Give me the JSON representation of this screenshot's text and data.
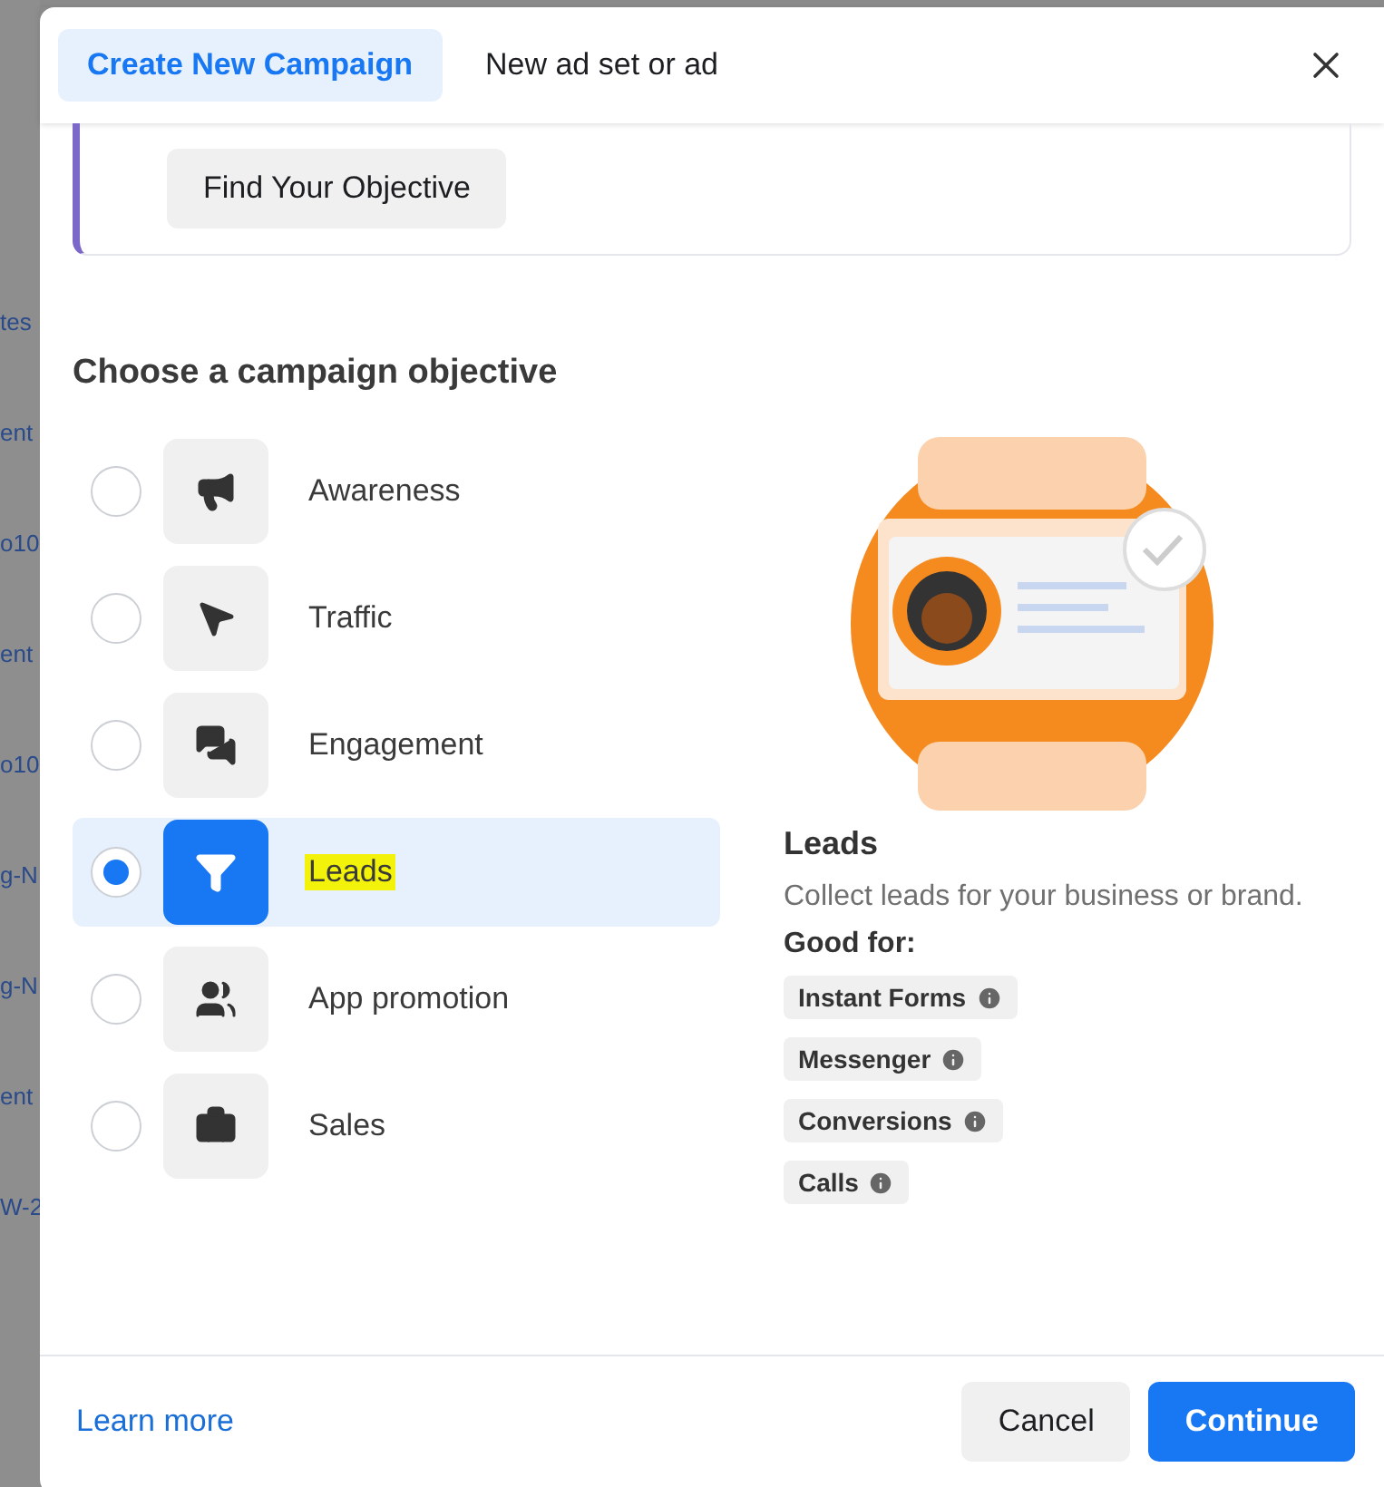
{
  "backdrop": {
    "fragments": [
      "tes",
      "ent",
      "o10",
      "ent",
      "o10",
      "g-N",
      "g-N",
      "ent",
      "W-2"
    ]
  },
  "tabs": [
    {
      "label": "Create New Campaign",
      "selected": true
    },
    {
      "label": "New ad set or ad",
      "selected": false
    }
  ],
  "banner": {
    "button": "Find Your Objective"
  },
  "heading": "Choose a campaign objective",
  "objectives": [
    {
      "label": "Awareness",
      "kind": "megaphone",
      "selected": false,
      "highlighted": false
    },
    {
      "label": "Traffic",
      "kind": "pointer",
      "selected": false,
      "highlighted": false
    },
    {
      "label": "Engagement",
      "kind": "chat",
      "selected": false,
      "highlighted": false
    },
    {
      "label": "Leads",
      "kind": "funnel",
      "selected": true,
      "highlighted": true
    },
    {
      "label": "App promotion",
      "kind": "people",
      "selected": false,
      "highlighted": false
    },
    {
      "label": "Sales",
      "kind": "bag",
      "selected": false,
      "highlighted": false
    }
  ],
  "details": {
    "title": "Leads",
    "description": "Collect leads for your business or brand.",
    "good_for_label": "Good for:",
    "tags": [
      "Instant Forms",
      "Messenger",
      "Conversions",
      "Calls"
    ]
  },
  "footer": {
    "link": "Learn more",
    "buttons": [
      {
        "label": "Cancel",
        "kind": "secondary"
      },
      {
        "label": "Continue",
        "kind": "primary"
      }
    ]
  }
}
